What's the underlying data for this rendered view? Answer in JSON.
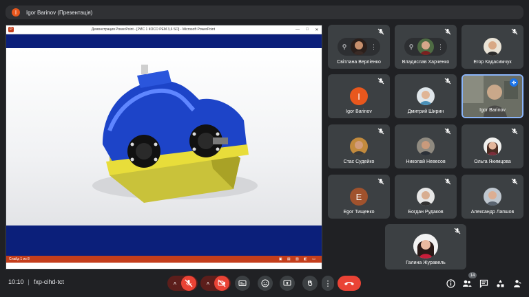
{
  "topbar": {
    "presenter_initial": "I",
    "title": "Igor Barinov (Презентація)"
  },
  "presentation": {
    "window_title": "Демонстрация PowerPoint - [РИС 1 КОСО РЕМ 3,6 SO] - Microsoft PowerPoint",
    "window_controls": [
      "—",
      "□",
      "✕"
    ],
    "status_text": "Слайд 1 из 8"
  },
  "participants": [
    {
      "name": "Світлана Верліенко",
      "pinned": true,
      "muted": true
    },
    {
      "name": "Владислав Харченко",
      "pinned": true,
      "muted": true
    },
    {
      "name": "Егор Кадасимчук",
      "muted": true
    },
    {
      "name": "Igor Barinov",
      "initial": "I",
      "avatar_color": "#e8571d",
      "muted": true
    },
    {
      "name": "Дмитрий Ширин",
      "muted": true
    },
    {
      "name": "Igor Barinov",
      "speaking": true
    },
    {
      "name": "Стас Судейко",
      "muted": true
    },
    {
      "name": "Николай Невесов",
      "muted": true
    },
    {
      "name": "Ольга Якимцова",
      "muted": true
    },
    {
      "name": "Egor Тищенко",
      "initial": "E",
      "avatar_color": "#a0522d",
      "muted": true
    },
    {
      "name": "Богдан Рудаков",
      "muted": true
    },
    {
      "name": "Александр Лапшов",
      "muted": true
    },
    {
      "name": "Галина Журавель",
      "muted": true
    }
  ],
  "meeting": {
    "time": "10:10",
    "separator": "|",
    "code": "fxp-cihd-tct"
  },
  "people_count": "14",
  "colors": {
    "background": "#202124",
    "tile": "#3c4043",
    "danger": "#ea4335",
    "accent": "#8ab4f8"
  }
}
